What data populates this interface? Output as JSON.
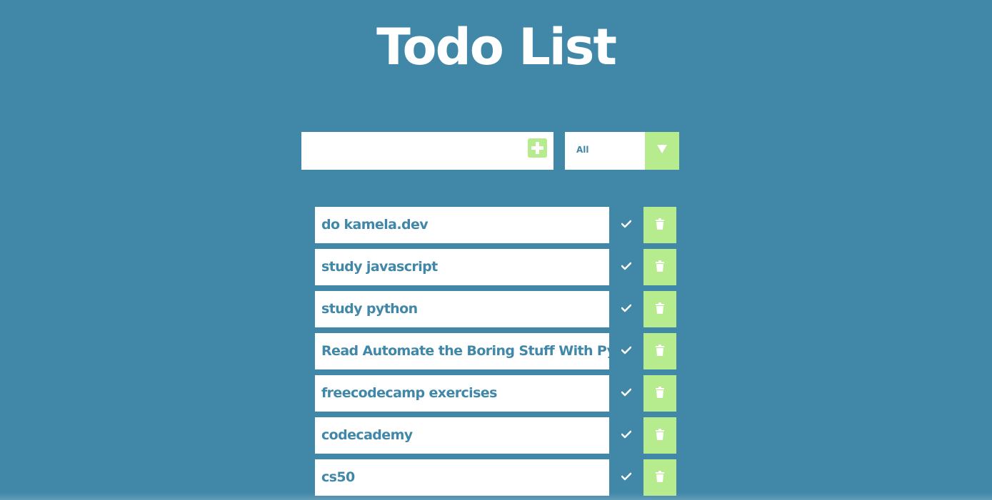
{
  "app": {
    "title": "Todo List"
  },
  "form": {
    "input_value": "",
    "input_placeholder": "",
    "add_icon": "plus-square-icon"
  },
  "filter": {
    "selected": "All",
    "icon": "triangle-down-icon"
  },
  "todos": [
    {
      "text": "do kamela.dev"
    },
    {
      "text": "study javascript"
    },
    {
      "text": "study python"
    },
    {
      "text": "Read Automate the Boring Stuff With Python"
    },
    {
      "text": "freecodecamp exercises"
    },
    {
      "text": "codecademy"
    },
    {
      "text": "cs50"
    }
  ],
  "icons": {
    "complete": "check-icon",
    "delete": "trash-icon"
  },
  "colors": {
    "background": "#4187a8",
    "accent": "#b7ec8e",
    "text": "#4187a8",
    "white": "#ffffff"
  }
}
